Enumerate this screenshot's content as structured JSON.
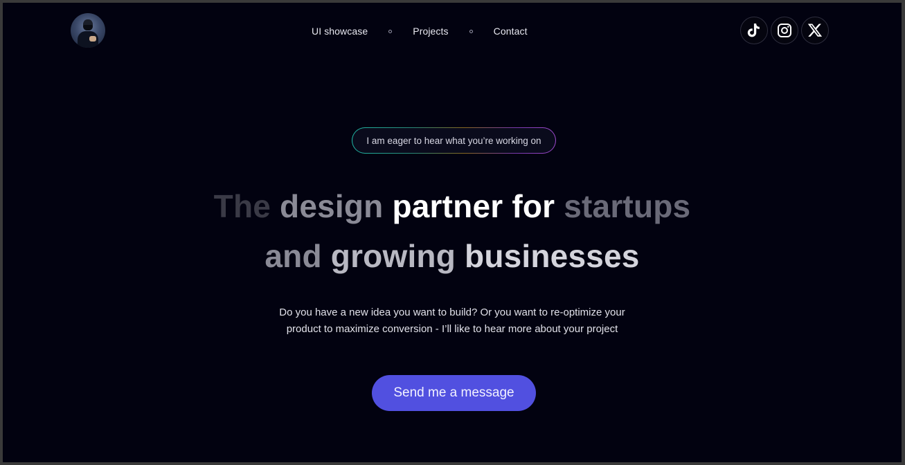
{
  "nav": {
    "items": [
      {
        "label": "UI showcase"
      },
      {
        "label": "Projects"
      },
      {
        "label": "Contact"
      }
    ]
  },
  "socials": [
    {
      "icon": "tiktok-icon"
    },
    {
      "icon": "instagram-icon"
    },
    {
      "icon": "x-icon"
    }
  ],
  "hero": {
    "badge": "I am eager to hear what you’re working on",
    "headline_line1": [
      {
        "text": "The",
        "color": "#3a3a46"
      },
      {
        "text": "design",
        "color": "#8a8a96"
      },
      {
        "text": "partner",
        "color": "#ffffff"
      },
      {
        "text": "for",
        "color": "#ffffff"
      },
      {
        "text": "startups",
        "color": "#6a6a78"
      }
    ],
    "headline_line2": [
      {
        "text": "and",
        "color": "#8a8a96"
      },
      {
        "text": "growing",
        "color": "#b8b8c2"
      },
      {
        "text": "businesses",
        "color": "#d4d4dc"
      }
    ],
    "lead_line1": "Do you have a new idea you want to build? Or you want to re-optimize your",
    "lead_line2": "product to maximize conversion - I’ll like to hear more about your project",
    "cta": "Send me a message"
  }
}
